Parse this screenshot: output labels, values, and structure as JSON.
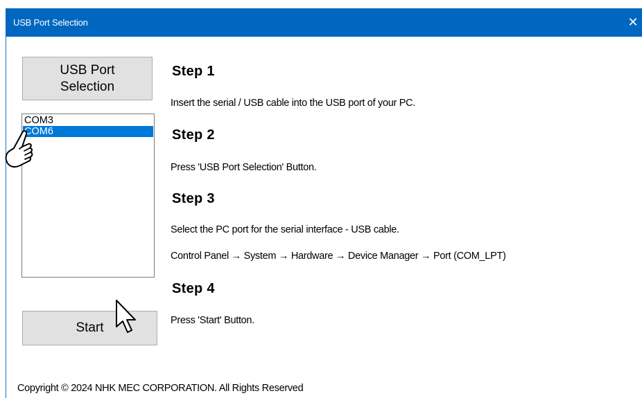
{
  "window": {
    "title": "USB Port Selection",
    "close_glyph": "✕"
  },
  "buttons": {
    "usb_port_selection_label": "USB Port Selection",
    "start_label": "Start"
  },
  "port_list": {
    "items": [
      "COM3",
      "COM6"
    ],
    "selected": "COM6"
  },
  "steps": [
    {
      "title": "Step 1",
      "lines": [
        "Insert the serial / USB cable into the USB port of your PC."
      ]
    },
    {
      "title": "Step 2",
      "lines": [
        "Press 'USB Port Selection' Button."
      ]
    },
    {
      "title": "Step 3",
      "lines": [
        "Select the PC port for the serial interface - USB cable.",
        "Control Panel → System → Hardware → Device Manager → Port (COM_LPT)"
      ]
    },
    {
      "title": "Step 4",
      "lines": [
        "Press 'Start' Button."
      ]
    }
  ],
  "footer": {
    "copyright": "Copyright © 2024 NHK MEC CORPORATION. All Rights Reserved"
  },
  "cursors": {
    "pointer_hand": "hand-pointer-icon",
    "arrow": "arrow-cursor-icon"
  },
  "colors": {
    "titlebar": "#0067c0",
    "selection": "#0078d7",
    "button_face": "#e1e1e1"
  }
}
